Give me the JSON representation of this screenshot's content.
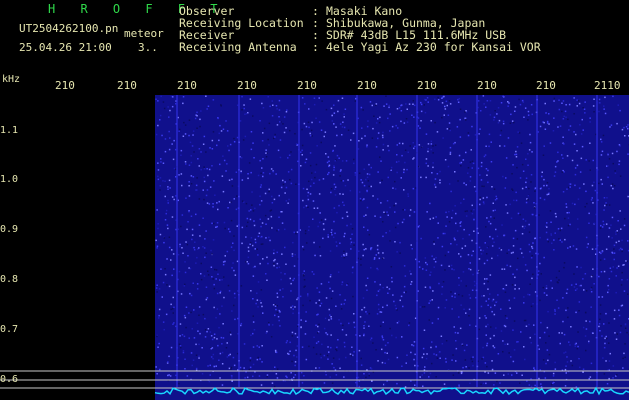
{
  "header": {
    "brand": "H R O F F T",
    "filename": "UT2504262100.pn",
    "tag": "meteor",
    "timestamp": "25.04.26 21:00",
    "counter": "3.."
  },
  "station": [
    {
      "label": "Observer",
      "value": "Masaki Kano"
    },
    {
      "label": "Receiving Location",
      "value": "Shibukawa, Gunma, Japan"
    },
    {
      "label": "Receiver",
      "value": "SDR# 43dB L15 111.6MHz USB"
    },
    {
      "label": "Receiving Antenna",
      "value": "4ele Yagi Az 230 for Kansai VOR"
    }
  ],
  "axis": {
    "unit": "kHz",
    "time_ticks": [
      "210",
      "210",
      "210",
      "210",
      "210",
      "210",
      "210",
      "210",
      "210",
      "2110"
    ],
    "freq_ticks": [
      "1.1",
      "1.0",
      "0.9",
      "0.8",
      "0.7",
      "0.6"
    ]
  },
  "colors": {
    "background": "#000000",
    "text": "#e6e6b0",
    "brand": "#2fd84a",
    "noise_base": "#10108c",
    "trace": "#19d6ff"
  }
}
